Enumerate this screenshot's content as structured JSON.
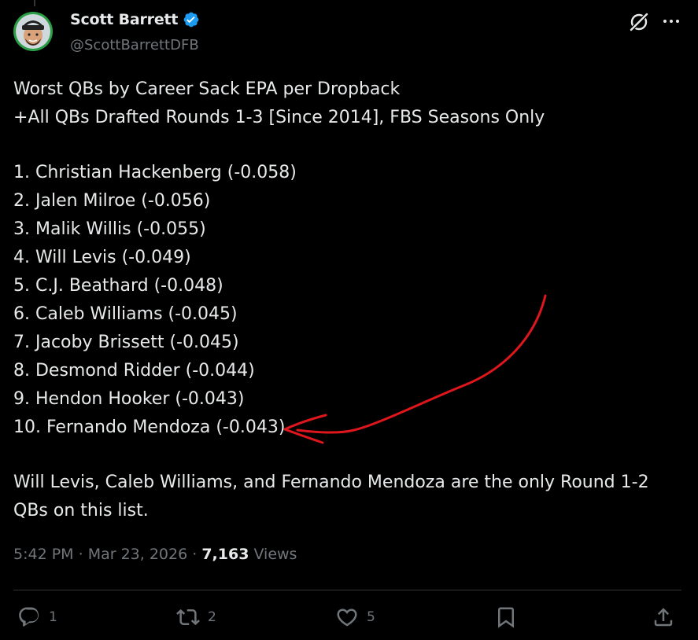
{
  "author": {
    "display_name": "Scott Barrett",
    "handle": "@ScottBarrettDFB",
    "verified": true,
    "verified_color": "#1d9bf0"
  },
  "header_icons": [
    "grok-icon",
    "more-icon"
  ],
  "tweet": {
    "title_line_1": "Worst QBs by Career Sack EPA per Dropback",
    "title_line_2": "+All QBs Drafted Rounds 1-3 [Since 2014], FBS Seasons Only",
    "list": [
      "1. Christian Hackenberg (-0.058)",
      "2. Jalen Milroe (-0.056)",
      "3. Malik Willis (-0.055)",
      "4. Will Levis (-0.049)",
      "5. C.J. Beathard (-0.048)",
      "6. Caleb Williams (-0.045)",
      "7. Jacoby Brissett (-0.045)",
      "8. Desmond Ridder (-0.044)",
      "9. Hendon Hooker (-0.043)",
      "10. Fernando Mendoza (-0.043)"
    ],
    "closing": "Will Levis, Caleb Williams, and Fernando Mendoza are the only Round 1-2 QBs on this list.",
    "annotation_color": "#e0161d"
  },
  "meta": {
    "time": "5:42 PM",
    "separator": " · ",
    "date": "Mar 23, 2026",
    "views_count": "7,163",
    "views_label": " Views"
  },
  "actions": {
    "reply_count": "1",
    "retweet_count": "2",
    "like_count": "5",
    "bookmark_icon": "bookmark-icon",
    "share_icon": "share-icon"
  },
  "colors": {
    "background": "#000000",
    "text": "#e7e9ea",
    "muted": "#71767b",
    "divider": "#2f3336"
  }
}
